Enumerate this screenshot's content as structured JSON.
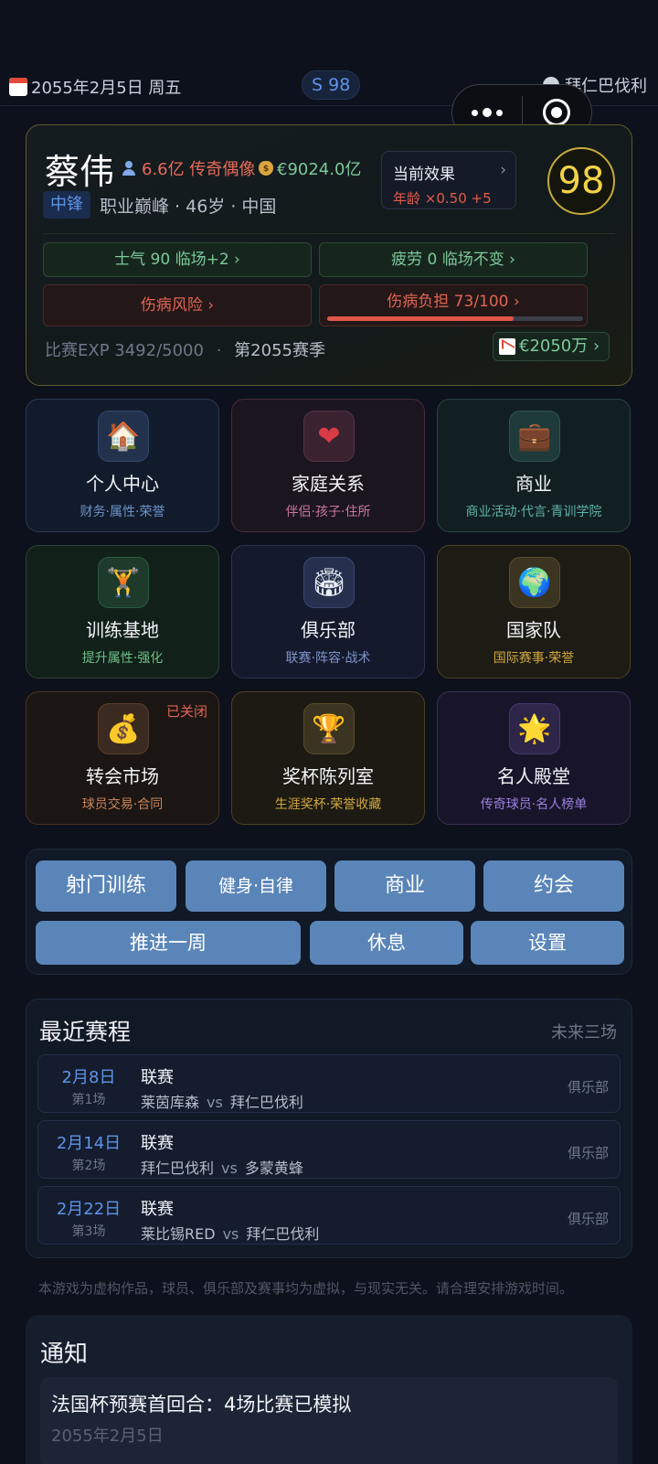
{
  "topbar": {
    "date": "2055年2月5日 周五",
    "season_badge": "S 98",
    "club": "拜仁巴伐利"
  },
  "profile": {
    "name": "蔡伟",
    "fans": "6.6亿 传奇偶像",
    "money": "€9024.0亿",
    "position": "中锋",
    "meta": "职业巅峰 · 46岁 · 中国",
    "effect_title": "当前效果",
    "effect_value": "年龄 ×0.50  +5",
    "overall": "98",
    "morale": "士气 90  临场+2 ›",
    "fatigue": "疲劳 0  临场不变 ›",
    "injury_risk": "伤病风险 ›",
    "injury_load": "伤病负担 73/100 ›",
    "injury_load_fraction": 0.73,
    "exp": "比赛EXP 3492/5000",
    "season": "第2055赛季",
    "wealth": "€2050万 ›"
  },
  "tiles": [
    {
      "title": "个人中心",
      "sub": "财务·属性·荣誉",
      "icon": "house-icon",
      "glyph": "🏠"
    },
    {
      "title": "家庭关系",
      "sub": "伴侣·孩子·住所",
      "icon": "heart-icon",
      "glyph": "❤"
    },
    {
      "title": "商业",
      "sub": "商业活动·代言·青训学院",
      "icon": "briefcase-icon",
      "glyph": "💼"
    },
    {
      "title": "训练基地",
      "sub": "提升属性·强化",
      "icon": "weightlifter-icon",
      "glyph": "🏋"
    },
    {
      "title": "俱乐部",
      "sub": "联赛·阵容·战术",
      "icon": "stadium-icon",
      "glyph": "🏟"
    },
    {
      "title": "国家队",
      "sub": "国际赛事·荣誉",
      "icon": "globe-icon",
      "glyph": "🌍"
    },
    {
      "title": "转会市场",
      "sub": "球员交易·合同",
      "icon": "money-bag-icon",
      "glyph": "💰",
      "tag": "已关闭"
    },
    {
      "title": "奖杯陈列室",
      "sub": "生涯奖杯·荣誉收藏",
      "icon": "trophy-icon",
      "glyph": "🏆"
    },
    {
      "title": "名人殿堂",
      "sub": "传奇球员·名人榜单",
      "icon": "star-icon",
      "glyph": "🌟"
    }
  ],
  "actions": {
    "shoot": "射门训练",
    "fitness": "健身·自律",
    "business": "商业",
    "date": "约会",
    "advance": "推进一周",
    "rest": "休息",
    "settings": "设置"
  },
  "schedule": {
    "title": "最近赛程",
    "more": "未来三场",
    "matches": [
      {
        "date": "2月8日",
        "round": "第1场",
        "type": "联赛",
        "home": "莱茵库森",
        "vs": "vs",
        "away": "拜仁巴伐利",
        "tag": "俱乐部"
      },
      {
        "date": "2月14日",
        "round": "第2场",
        "type": "联赛",
        "home": "拜仁巴伐利",
        "vs": "vs",
        "away": "多蒙黄蜂",
        "tag": "俱乐部"
      },
      {
        "date": "2月22日",
        "round": "第3场",
        "type": "联赛",
        "home": "莱比锡RED",
        "vs": "vs",
        "away": "拜仁巴伐利",
        "tag": "俱乐部"
      }
    ]
  },
  "disclaimer": "本游戏为虚构作品，球员、俱乐部及赛事均为虚拟，与现实无关。请合理安排游戏时间。",
  "notice": {
    "title": "通知",
    "items": [
      {
        "text": "法国杯预赛首回合：4场比赛已模拟",
        "date": "2055年2月5日"
      }
    ]
  }
}
